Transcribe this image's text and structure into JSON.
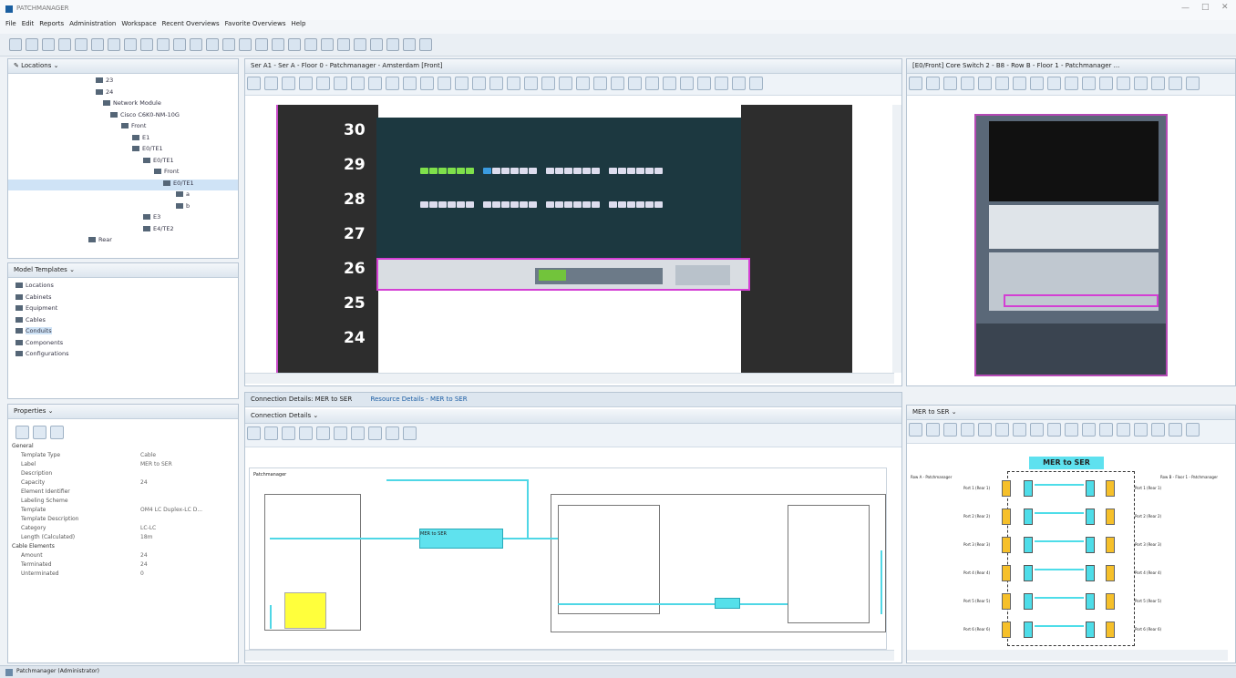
{
  "app": {
    "title": "PATCHMANAGER"
  },
  "menu": [
    "File",
    "Edit",
    "Reports",
    "Administration",
    "Workspace",
    "Recent Overviews",
    "Favorite Overviews",
    "Help"
  ],
  "locations": {
    "title": "Locations",
    "tree": [
      "23",
      "24",
      "Network Module",
      "Cisco C6K0-NM-10G",
      "Front",
      "E1",
      "E0/TE1",
      "E0/TE1",
      "Front",
      "E0/TE1",
      "a",
      "b",
      "E3",
      "E4/TE2",
      "Rear"
    ]
  },
  "model_templates": {
    "title": "Model Templates",
    "items": [
      "Locations",
      "Cabinets",
      "Equipment",
      "Cables",
      "Conduits",
      "Components",
      "Configurations"
    ]
  },
  "properties": {
    "title": "Properties",
    "rows": [
      {
        "k": "General",
        "v": ""
      },
      {
        "k": "Template Type",
        "v": "Cable"
      },
      {
        "k": "Label",
        "v": "MER to SER"
      },
      {
        "k": "Description",
        "v": ""
      },
      {
        "k": "Capacity",
        "v": "24"
      },
      {
        "k": "Element Identifier",
        "v": ""
      },
      {
        "k": "Labeling Scheme",
        "v": ""
      },
      {
        "k": "Template",
        "v": "OM4 LC Duplex-LC D..."
      },
      {
        "k": "Template Description",
        "v": ""
      },
      {
        "k": "Category",
        "v": "LC-LC"
      },
      {
        "k": "Length (Calculated)",
        "v": "18m"
      },
      {
        "k": "Cable Elements",
        "v": ""
      },
      {
        "k": "Amount",
        "v": "24"
      },
      {
        "k": "Terminated",
        "v": "24"
      },
      {
        "k": "Unterminated",
        "v": "0"
      }
    ]
  },
  "rack_view": {
    "tab": "Ser A1 - Ser A - Floor 0 - Patchmanager - Amsterdam [Front]",
    "units": [
      "30",
      "29",
      "28",
      "27",
      "26",
      "25",
      "24"
    ],
    "zoom": "100"
  },
  "switch_view": {
    "tab": "[E0/Front] Core Switch 2 - B8 - Row B - Floor 1 - Patchmanager ..."
  },
  "connection": {
    "tab1": "Connection Details: MER to SER",
    "tab2": "Resource Details - MER to SER",
    "inner": "Connection Details",
    "canvas_label": "Patchmanager",
    "center_label": "MER to SER",
    "zoom": "100"
  },
  "mer": {
    "tab": "MER to SER",
    "title": "MER to SER",
    "rows": [
      "Port 1 (Rear 1)",
      "Port 2 (Rear 2)",
      "Port 3 (Rear 3)",
      "Port 4 (Rear 4)",
      "Port 5 (Rear 5)",
      "Port 6 (Rear 6)"
    ],
    "left_head": "Row A - Patchmanager",
    "right_head": "Row B - Floor 1 - Patchmanager"
  },
  "status": {
    "text": "Patchmanager (Administrator)"
  }
}
